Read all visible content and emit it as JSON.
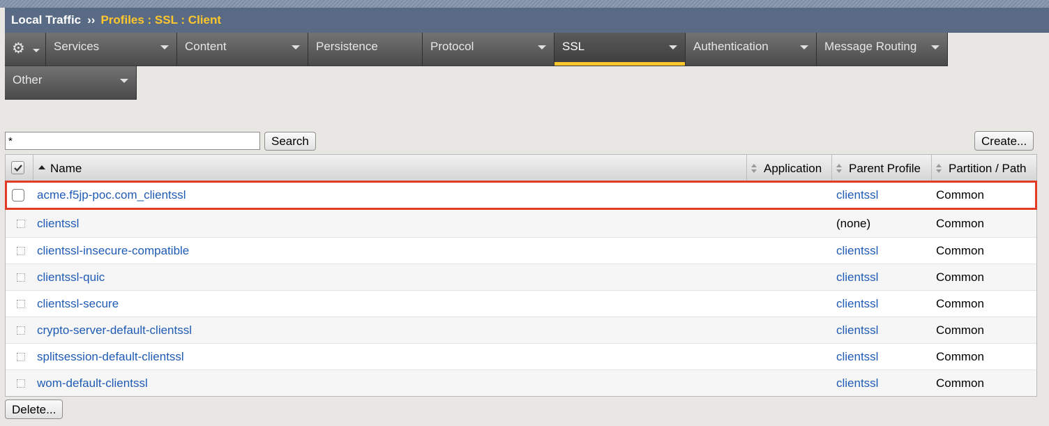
{
  "header": {
    "section": "Local Traffic",
    "separator": "››",
    "breadcrumb": "Profiles : SSL : Client"
  },
  "tabs": {
    "gear_icon": "gear-icon",
    "row1": [
      "Services",
      "Content",
      "Persistence",
      "Protocol",
      "SSL",
      "Authentication",
      "Message Routing"
    ],
    "row2": [
      "Other"
    ],
    "active": "SSL"
  },
  "search": {
    "value": "*",
    "button_label": "Search"
  },
  "create_label": "Create...",
  "delete_label": "Delete...",
  "table": {
    "columns": {
      "name": "Name",
      "application": "Application",
      "parent_profile": "Parent Profile",
      "partition_path": "Partition / Path"
    },
    "rows": [
      {
        "name": "acme.f5jp-poc.com_clientssl",
        "application": "",
        "parent": "clientssl",
        "partition": "Common"
      },
      {
        "name": "clientssl",
        "application": "",
        "parent": "(none)",
        "partition": "Common"
      },
      {
        "name": "clientssl-insecure-compatible",
        "application": "",
        "parent": "clientssl",
        "partition": "Common"
      },
      {
        "name": "clientssl-quic",
        "application": "",
        "parent": "clientssl",
        "partition": "Common"
      },
      {
        "name": "clientssl-secure",
        "application": "",
        "parent": "clientssl",
        "partition": "Common"
      },
      {
        "name": "crypto-server-default-clientssl",
        "application": "",
        "parent": "clientssl",
        "partition": "Common"
      },
      {
        "name": "splitsession-default-clientssl",
        "application": "",
        "parent": "clientssl",
        "partition": "Common"
      },
      {
        "name": "wom-default-clientssl",
        "application": "",
        "parent": "clientssl",
        "partition": "Common"
      }
    ]
  },
  "colors": {
    "header_bg": "#596b84",
    "breadcrumb": "#ffc72c",
    "active_tab_underline": "#ffc72c",
    "link": "#1f5bb5",
    "highlight_outline": "#e23a25"
  }
}
